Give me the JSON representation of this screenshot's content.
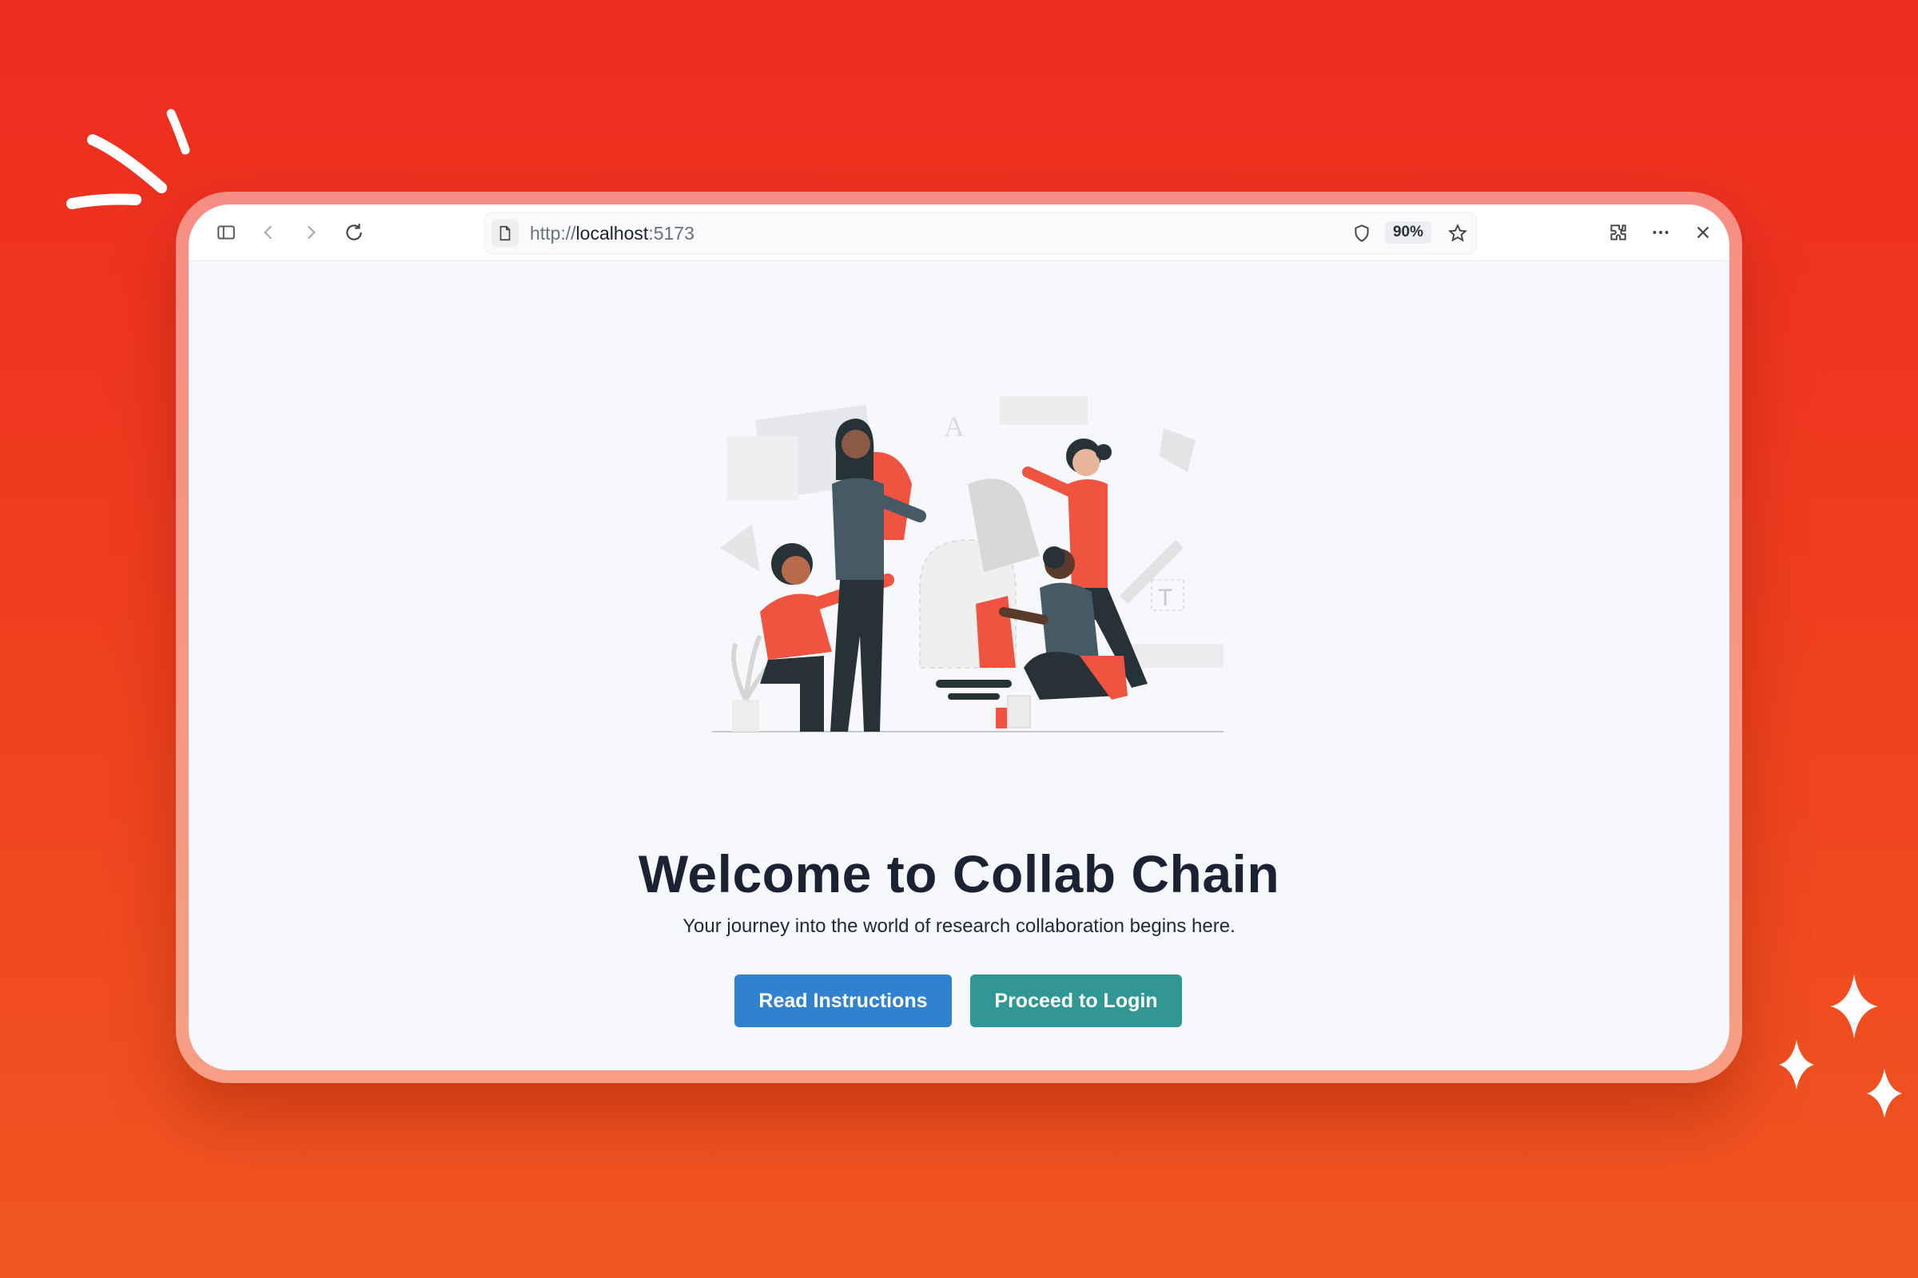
{
  "browser": {
    "url_scheme": "http://",
    "url_host": "localhost",
    "url_port": ":5173",
    "zoom": "90%",
    "icons": [
      "sidebar-icon",
      "back-icon",
      "forward-icon",
      "reload-icon",
      "page-icon",
      "shield-icon",
      "star-icon",
      "extensions-icon",
      "more-icon",
      "close-icon"
    ]
  },
  "page": {
    "title": "Welcome to Collab Chain",
    "subtitle": "Your journey into the world of research collaboration begins here.",
    "read_button": "Read Instructions",
    "login_button": "Proceed to Login",
    "illustration": "team-puzzle-illustration"
  },
  "colors": {
    "background_top": "#ee2b1f",
    "background_bottom": "#f0561f",
    "page_bg": "#f6f8fb",
    "title": "#1a2233",
    "read_button": "#3182ce",
    "login_button": "#319795",
    "illustration_accent": "#f0533f"
  }
}
